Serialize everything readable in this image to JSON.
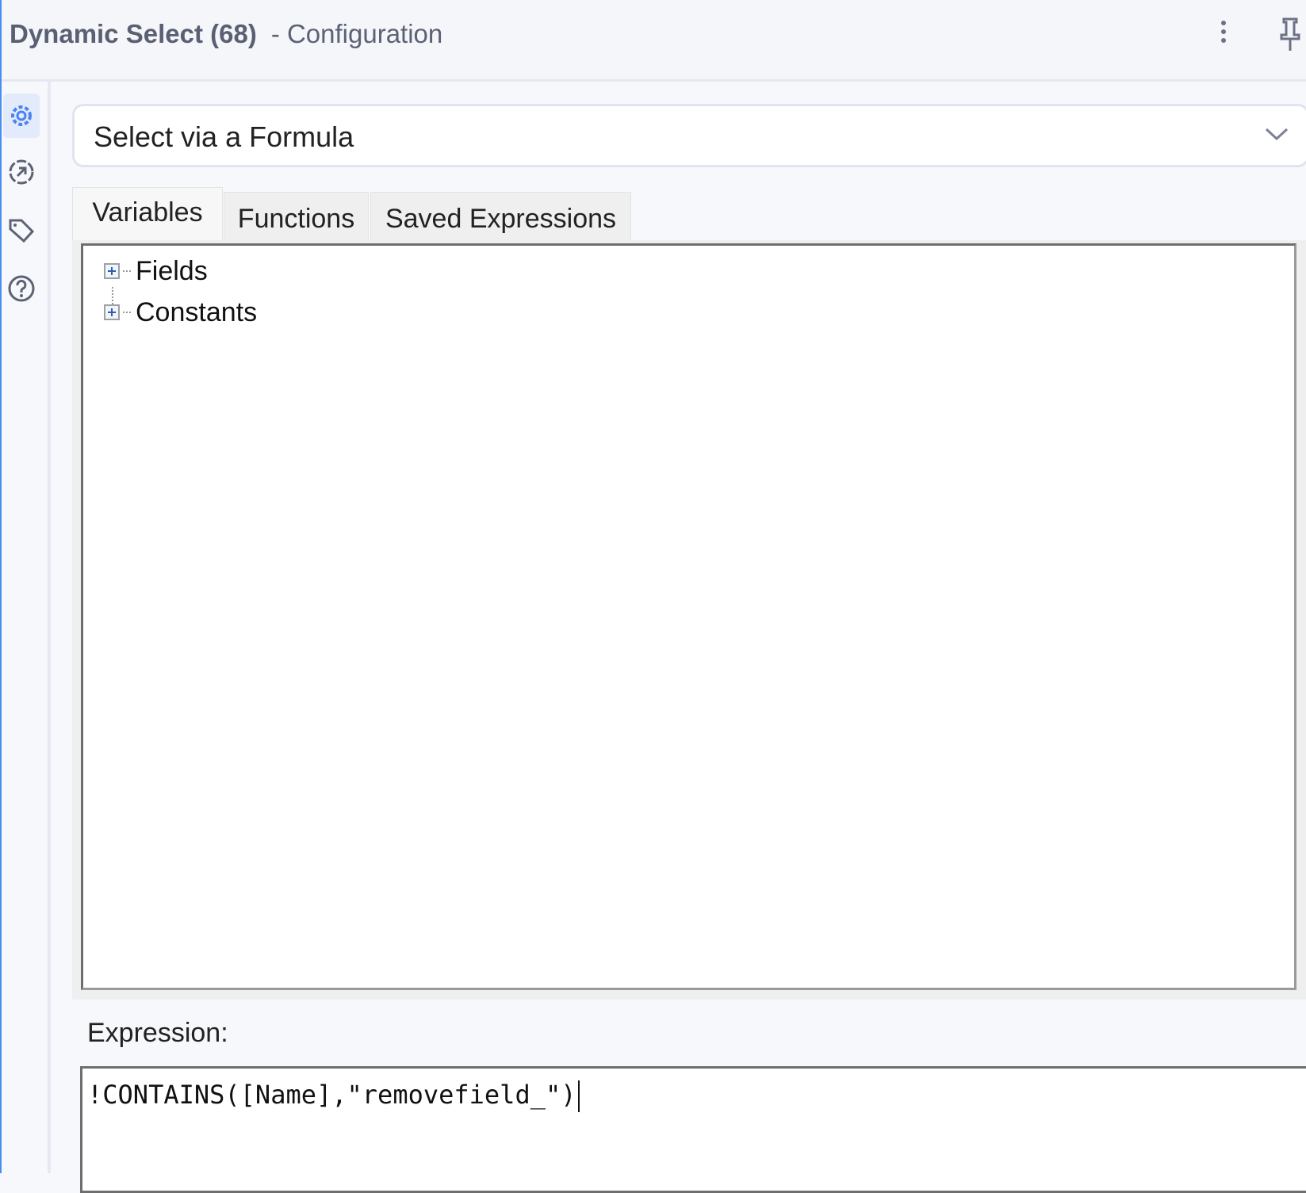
{
  "header": {
    "tool_name": "Dynamic Select (68)",
    "subtitle": "- Configuration"
  },
  "sidebar": {
    "items": [
      {
        "icon": "gear-icon",
        "active": true
      },
      {
        "icon": "output-arrow-icon",
        "active": false
      },
      {
        "icon": "tag-icon",
        "active": false
      },
      {
        "icon": "help-icon",
        "active": false
      }
    ]
  },
  "mode_select": {
    "value": "Select via a Formula"
  },
  "tabs": [
    {
      "label": "Variables"
    },
    {
      "label": "Functions"
    },
    {
      "label": "Saved Expressions"
    }
  ],
  "tree": {
    "nodes": [
      {
        "label": "Fields"
      },
      {
        "label": "Constants"
      }
    ]
  },
  "expression": {
    "label": "Expression:",
    "value": "!CONTAINS([Name],\"removefield_\")"
  },
  "colors": {
    "accent": "#4a8ef0",
    "active_bg": "#e2eafc"
  }
}
